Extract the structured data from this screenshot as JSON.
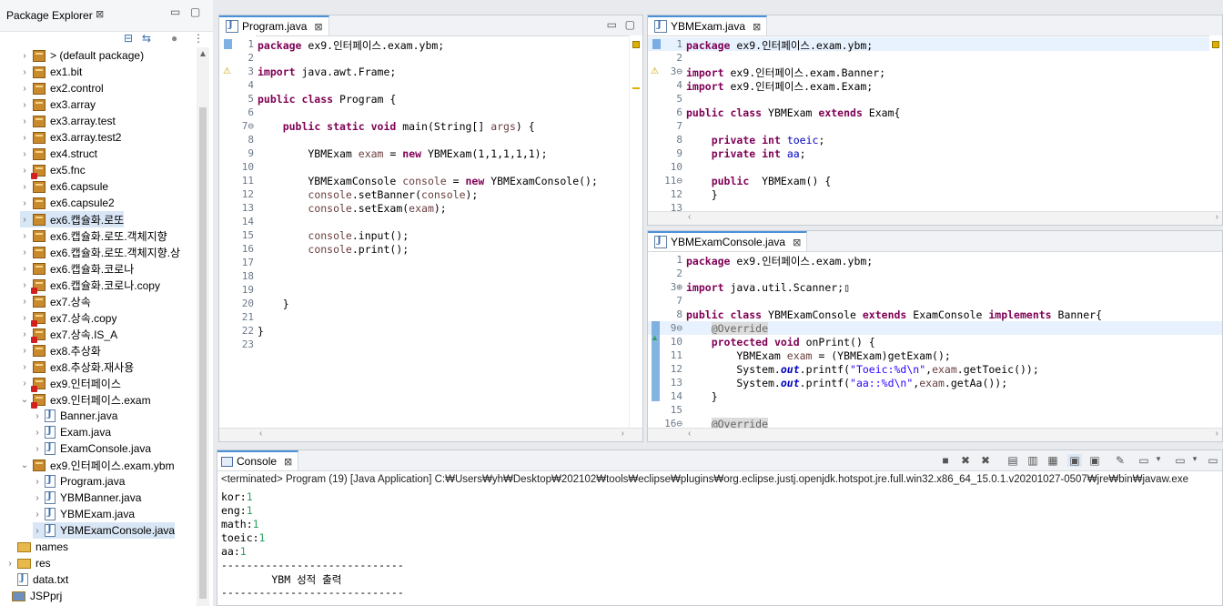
{
  "package_explorer": {
    "title": "Package Explorer",
    "items": [
      {
        "label": "> (default package)",
        "kind": "pkg",
        "depth": 1,
        "chev": ">",
        "error": false
      },
      {
        "label": "ex1.bit",
        "kind": "pkg",
        "depth": 1,
        "chev": ">",
        "error": false
      },
      {
        "label": "ex2.control",
        "kind": "pkg",
        "depth": 1,
        "chev": ">",
        "error": false
      },
      {
        "label": "ex3.array",
        "kind": "pkg",
        "depth": 1,
        "chev": ">",
        "error": false
      },
      {
        "label": "ex3.array.test",
        "kind": "pkg",
        "depth": 1,
        "chev": ">",
        "error": false
      },
      {
        "label": "ex3.array.test2",
        "kind": "pkg",
        "depth": 1,
        "chev": ">",
        "error": false
      },
      {
        "label": "ex4.struct",
        "kind": "pkg",
        "depth": 1,
        "chev": ">",
        "error": false
      },
      {
        "label": "ex5.fnc",
        "kind": "pkg",
        "depth": 1,
        "chev": ">",
        "error": true
      },
      {
        "label": "ex6.capsule",
        "kind": "pkg",
        "depth": 1,
        "chev": ">",
        "error": false
      },
      {
        "label": "ex6.capsule2",
        "kind": "pkg",
        "depth": 1,
        "chev": ">",
        "error": false
      },
      {
        "label": "ex6.캡슐화.로또",
        "kind": "pkg",
        "depth": 1,
        "chev": ">",
        "error": false,
        "selected": true
      },
      {
        "label": "ex6.캡슐화.로또.객체지향",
        "kind": "pkg",
        "depth": 1,
        "chev": ">",
        "error": false
      },
      {
        "label": "ex6.캡슐화.로또.객체지향.상",
        "kind": "pkg",
        "depth": 1,
        "chev": ">",
        "error": false
      },
      {
        "label": "ex6.캡슐화.코로나",
        "kind": "pkg",
        "depth": 1,
        "chev": ">",
        "error": false
      },
      {
        "label": "ex6.캡슐화.코로나.copy",
        "kind": "pkg",
        "depth": 1,
        "chev": ">",
        "error": true
      },
      {
        "label": "ex7.상속",
        "kind": "pkg",
        "depth": 1,
        "chev": ">",
        "error": false
      },
      {
        "label": "ex7.상속.copy",
        "kind": "pkg",
        "depth": 1,
        "chev": ">",
        "error": true
      },
      {
        "label": "ex7.상속.IS_A",
        "kind": "pkg",
        "depth": 1,
        "chev": ">",
        "error": true
      },
      {
        "label": "ex8.추상화",
        "kind": "pkg",
        "depth": 1,
        "chev": ">",
        "error": false
      },
      {
        "label": "ex8.추상화.재사용",
        "kind": "pkg",
        "depth": 1,
        "chev": ">",
        "error": false
      },
      {
        "label": "ex9.인터페이스",
        "kind": "pkg",
        "depth": 1,
        "chev": ">",
        "error": true
      },
      {
        "label": "ex9.인터페이스.exam",
        "kind": "pkg",
        "depth": 1,
        "chev": "v",
        "error": true
      },
      {
        "label": "Banner.java",
        "kind": "java",
        "depth": 2,
        "chev": ">",
        "error": false
      },
      {
        "label": "Exam.java",
        "kind": "java",
        "depth": 2,
        "chev": ">",
        "error": false
      },
      {
        "label": "ExamConsole.java",
        "kind": "java",
        "depth": 2,
        "chev": ">",
        "error": false
      },
      {
        "label": "ex9.인터페이스.exam.ybm",
        "kind": "pkg",
        "depth": 1,
        "chev": "v",
        "error": false
      },
      {
        "label": "Program.java",
        "kind": "java",
        "depth": 2,
        "chev": ">",
        "error": false
      },
      {
        "label": "YBMBanner.java",
        "kind": "java",
        "depth": 2,
        "chev": ">",
        "error": false
      },
      {
        "label": "YBMExam.java",
        "kind": "java",
        "depth": 2,
        "chev": ">",
        "error": false
      },
      {
        "label": "YBMExamConsole.java",
        "kind": "java",
        "depth": 2,
        "chev": ">",
        "error": false,
        "selected": true
      },
      {
        "label": "names",
        "kind": "folder",
        "depth": 0,
        "chev": "",
        "error": false
      },
      {
        "label": "res",
        "kind": "folder",
        "depth": 0,
        "chev": ">",
        "error": false
      },
      {
        "label": "data.txt",
        "kind": "file",
        "depth": 0,
        "chev": "",
        "error": false
      },
      {
        "label": "JSPprj",
        "kind": "project",
        "depth": -1,
        "chev": "",
        "error": false
      }
    ]
  },
  "editors": {
    "program": {
      "tab_label": "Program.java",
      "lines": [
        {
          "n": "1",
          "h": "<span class=\"kw\">package</span> ex9.인터페이스.exam.ybm;"
        },
        {
          "n": "2",
          "h": ""
        },
        {
          "n": "3",
          "h": "<span class=\"kw\">import</span> java.awt.Frame;"
        },
        {
          "n": "4",
          "h": ""
        },
        {
          "n": "5",
          "h": "<span class=\"kw\">public class</span> Program {"
        },
        {
          "n": "6",
          "h": ""
        },
        {
          "n": "7⊖",
          "h": "    <span class=\"kw\">public static void</span> main(String[] <span class=\"var\">args</span>) {"
        },
        {
          "n": "8",
          "h": ""
        },
        {
          "n": "9",
          "h": "        YBMExam <span class=\"var\">exam</span> = <span class=\"kw\">new</span> YBMExam(1,1,1,1,1);"
        },
        {
          "n": "10",
          "h": ""
        },
        {
          "n": "11",
          "h": "        YBMExamConsole <span class=\"var\">console</span> = <span class=\"kw\">new</span> YBMExamConsole();"
        },
        {
          "n": "12",
          "h": "        <span class=\"var\">console</span>.setBanner(<span class=\"var\">console</span>);"
        },
        {
          "n": "13",
          "h": "        <span class=\"var\">console</span>.setExam(<span class=\"var\">exam</span>);"
        },
        {
          "n": "14",
          "h": ""
        },
        {
          "n": "15",
          "h": "        <span class=\"var\">console</span>.input();"
        },
        {
          "n": "16",
          "h": "        <span class=\"var\">console</span>.print();"
        },
        {
          "n": "17",
          "h": ""
        },
        {
          "n": "18",
          "h": ""
        },
        {
          "n": "19",
          "h": ""
        },
        {
          "n": "20",
          "h": "    }"
        },
        {
          "n": "21",
          "h": ""
        },
        {
          "n": "22",
          "h": "}"
        },
        {
          "n": "23",
          "h": ""
        }
      ]
    },
    "ybmexam": {
      "tab_label": "YBMExam.java",
      "lines": [
        {
          "n": "1",
          "h": "<span class=\"kw\">package</span> ex9.인터페이스.exam.ybm;"
        },
        {
          "n": "2",
          "h": ""
        },
        {
          "n": "3⊖",
          "h": "<span class=\"kw\">import</span> ex9.인터페이스.exam.Banner;"
        },
        {
          "n": "4",
          "h": "<span class=\"kw\">import</span> ex9.인터페이스.exam.Exam;"
        },
        {
          "n": "5",
          "h": ""
        },
        {
          "n": "6",
          "h": "<span class=\"kw\">public class</span> YBMExam <span class=\"kw\">extends</span> Exam{"
        },
        {
          "n": "7",
          "h": ""
        },
        {
          "n": "8",
          "h": "    <span class=\"kw\">private int</span> <span class=\"fld\">toeic</span>;"
        },
        {
          "n": "9",
          "h": "    <span class=\"kw\">private int</span> <span class=\"fld\">aa</span>;"
        },
        {
          "n": "10",
          "h": ""
        },
        {
          "n": "11⊖",
          "h": "    <span class=\"kw\">public</span>  YBMExam() {"
        },
        {
          "n": "12",
          "h": "    }"
        },
        {
          "n": "13",
          "h": ""
        }
      ]
    },
    "ybmexamconsole": {
      "tab_label": "YBMExamConsole.java",
      "lines": [
        {
          "n": "1",
          "h": "<span class=\"kw\">package</span> ex9.인터페이스.exam.ybm;"
        },
        {
          "n": "2",
          "h": ""
        },
        {
          "n": "3⊕",
          "h": "<span class=\"kw\">import</span> java.util.Scanner;▯"
        },
        {
          "n": "7",
          "h": ""
        },
        {
          "n": "8",
          "h": "<span class=\"kw\">public class</span> YBMExamConsole <span class=\"kw\">extends</span> ExamConsole <span class=\"kw\">implements</span> Banner{"
        },
        {
          "n": "9⊖",
          "h": "    <span class=\"ann\">@Override</span>"
        },
        {
          "n": "10",
          "h": "    <span class=\"kw\">protected void</span> onPrint() {"
        },
        {
          "n": "11",
          "h": "        YBMExam <span class=\"var\">exam</span> = (YBMExam)getExam();"
        },
        {
          "n": "12",
          "h": "        System.<span class=\"stat\">out</span>.printf(<span class=\"str\">\"Toeic:%d\\n\"</span>,<span class=\"var\">exam</span>.getToeic());"
        },
        {
          "n": "13",
          "h": "        System.<span class=\"stat\">out</span>.printf(<span class=\"str\">\"aa::%d\\n\"</span>,<span class=\"var\">exam</span>.getAa());"
        },
        {
          "n": "14",
          "h": "    }"
        },
        {
          "n": "15",
          "h": ""
        },
        {
          "n": "16⊖",
          "h": "    <span class=\"ann\">@Override</span>"
        }
      ]
    }
  },
  "console": {
    "tab_label": "Console",
    "status_line": "<terminated> Program (19) [Java Application] C:₩Users₩yh₩Desktop₩202102₩tools₩eclipse₩plugins₩org.eclipse.justj.openjdk.hotspot.jre.full.win32.x86_64_15.0.1.v20201027-0507₩jre₩bin₩javaw.exe",
    "output": [
      {
        "label": "kor:",
        "value": "1"
      },
      {
        "label": "eng:",
        "value": "1"
      },
      {
        "label": "math:",
        "value": "1"
      },
      {
        "label": "toeic:",
        "value": "1"
      },
      {
        "label": "aa:",
        "value": "1"
      }
    ],
    "divider": "-----------------------------",
    "banner": "        YBM 성적 출력",
    "divider2": "-----------------------------"
  }
}
